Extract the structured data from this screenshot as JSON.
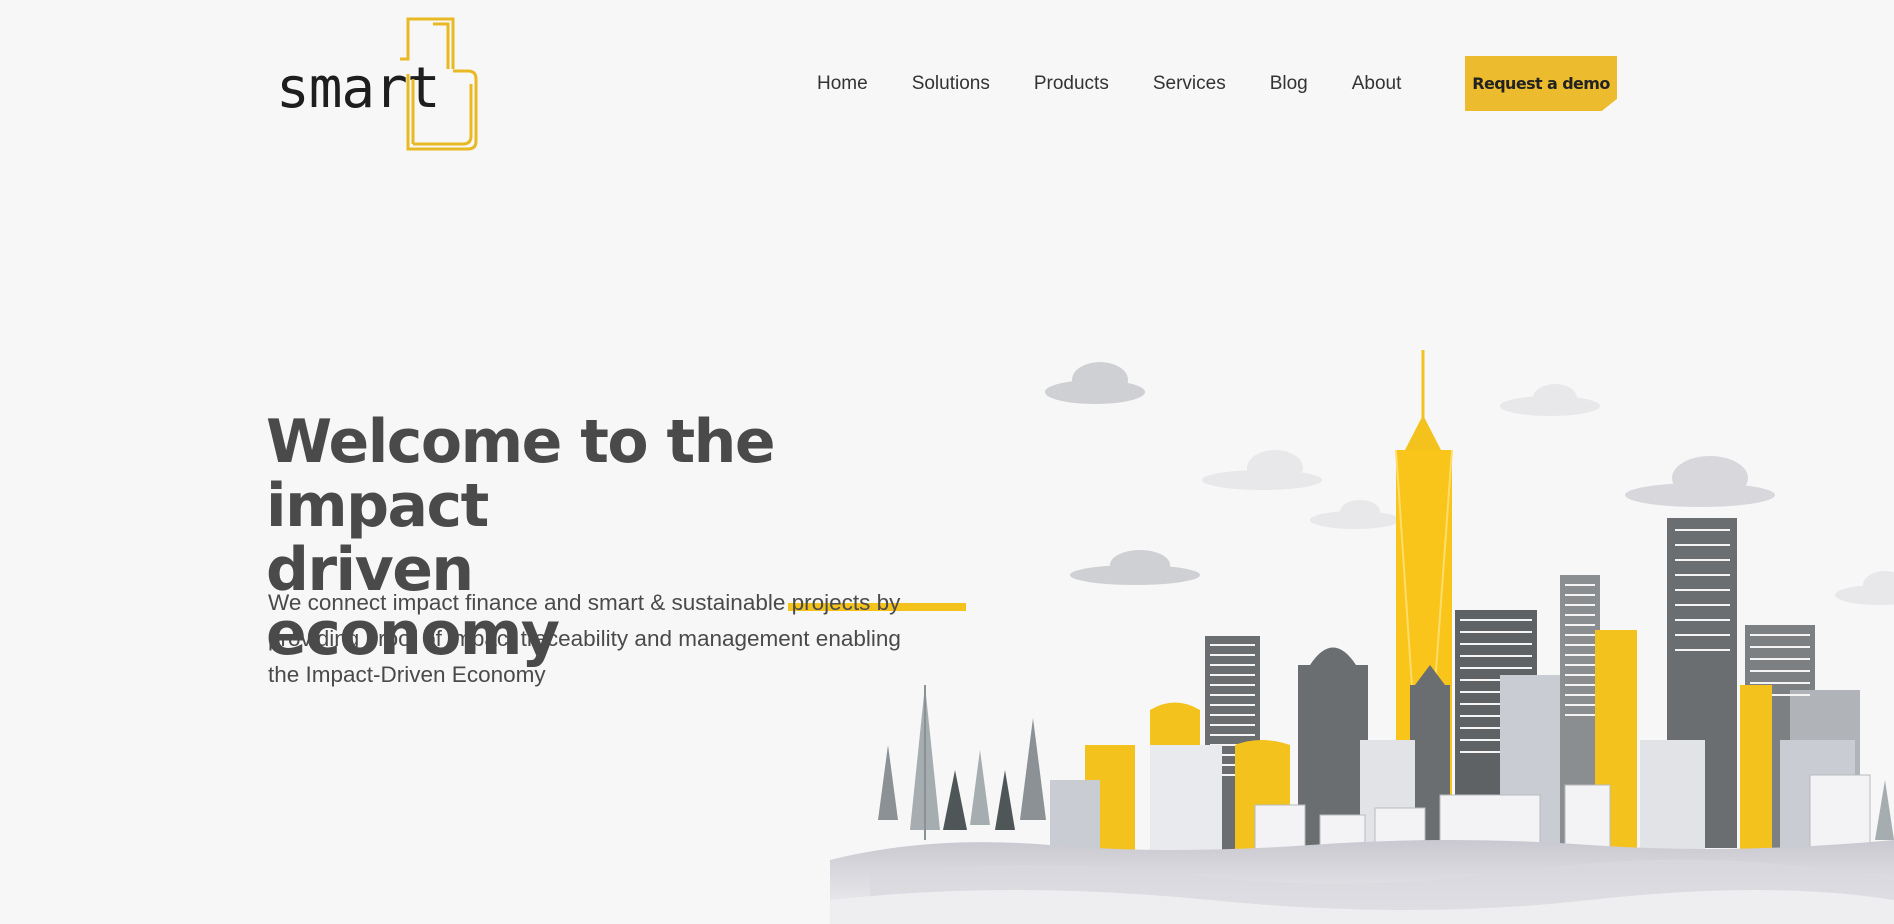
{
  "brand": {
    "logo_text": "smart"
  },
  "nav": {
    "items": [
      {
        "id": "home",
        "label": "Home"
      },
      {
        "id": "solutions",
        "label": "Solutions"
      },
      {
        "id": "products",
        "label": "Products"
      },
      {
        "id": "services",
        "label": "Services"
      },
      {
        "id": "blog",
        "label": "Blog"
      },
      {
        "id": "about",
        "label": "About"
      }
    ],
    "cta_label": "Request a demo"
  },
  "hero": {
    "title_line1": "Welcome to the impact",
    "title_line2": "driven economy",
    "description": "We connect impact finance and smart & sustainable projects by providing proof of impact traceability and management enabling the Impact-Driven Economy"
  },
  "colors": {
    "accent": "#f4c21c",
    "button": "#ecbc2e",
    "text": "#4a4a4a",
    "background": "#f7f7f7",
    "building_dark": "#6b6e70",
    "building_light": "#c9ccd2"
  },
  "icons": {
    "logo_mark": "bracket-b-logo-icon",
    "illustration": "city-skyline-illustration"
  }
}
